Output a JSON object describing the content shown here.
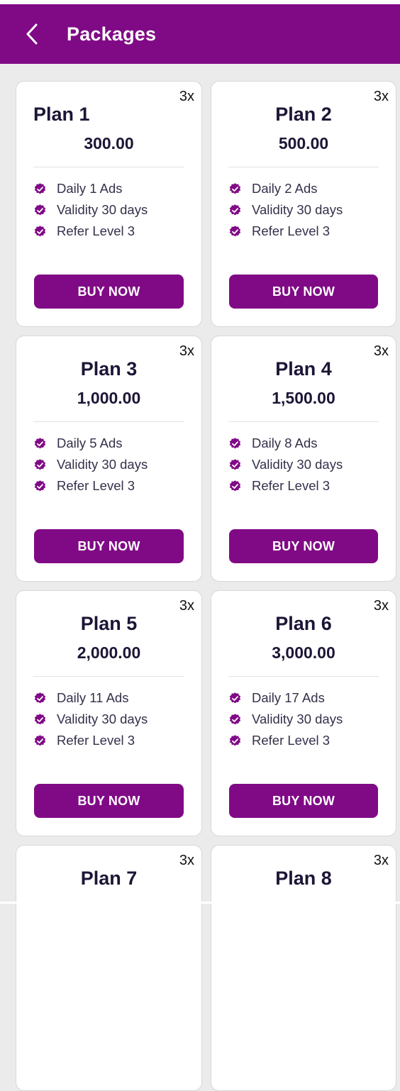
{
  "header": {
    "title": "Packages",
    "back_icon": "chevron-left-icon",
    "background": "#800a86"
  },
  "plans": [
    {
      "name": "Plan 1",
      "price": "300.00",
      "multiplier": "3x",
      "features": [
        "Daily 1 Ads",
        "Validity 30 days",
        "Refer Level 3"
      ],
      "button": "BUY NOW"
    },
    {
      "name": "Plan 2",
      "price": "500.00",
      "multiplier": "3x",
      "features": [
        "Daily 2 Ads",
        "Validity 30 days",
        "Refer Level 3"
      ],
      "button": "BUY NOW"
    },
    {
      "name": "Plan 3",
      "price": "1,000.00",
      "multiplier": "3x",
      "features": [
        "Daily 5 Ads",
        "Validity 30 days",
        "Refer Level 3"
      ],
      "button": "BUY NOW"
    },
    {
      "name": "Plan 4",
      "price": "1,500.00",
      "multiplier": "3x",
      "features": [
        "Daily 8 Ads",
        "Validity 30 days",
        "Refer Level 3"
      ],
      "button": "BUY NOW"
    },
    {
      "name": "Plan 5",
      "price": "2,000.00",
      "multiplier": "3x",
      "features": [
        "Daily 11 Ads",
        "Validity 30 days",
        "Refer Level 3"
      ],
      "button": "BUY NOW"
    },
    {
      "name": "Plan 6",
      "price": "3,000.00",
      "multiplier": "3x",
      "features": [
        "Daily 17 Ads",
        "Validity 30 days",
        "Refer Level 3"
      ],
      "button": "BUY NOW"
    },
    {
      "name": "Plan 7",
      "multiplier": "3x"
    },
    {
      "name": "Plan 8",
      "multiplier": "3x"
    }
  ],
  "colors": {
    "accent": "#800a86",
    "check": "#800a86",
    "text": "#1d1536",
    "background": "#ebebeb"
  },
  "feature_icon": "verified-check-icon"
}
